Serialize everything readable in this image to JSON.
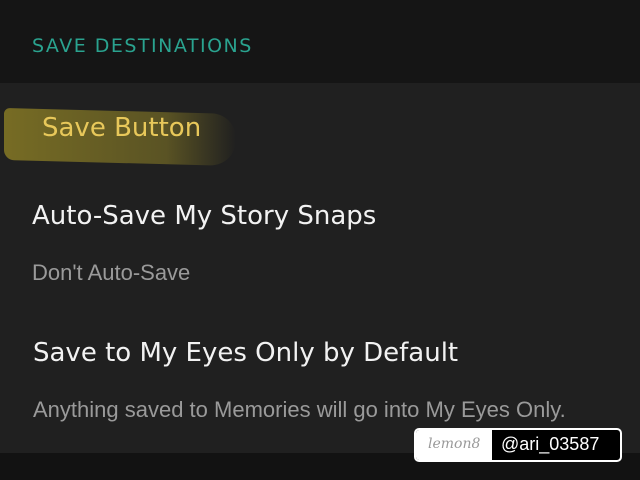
{
  "header": {
    "section_title": "SAVE DESTINATIONS"
  },
  "annotation": {
    "highlighted_label": "Save Button"
  },
  "settings": [
    {
      "title": "Auto-Save My Story Snaps",
      "subtitle": "Don't Auto-Save"
    },
    {
      "title": "Save to My Eyes Only by Default",
      "subtitle": "Anything saved to Memories will go into My Eyes Only."
    }
  ],
  "watermark": {
    "logo_text": "lemon8",
    "handle": "@ari_03587"
  },
  "colors": {
    "accent": "#2aa38f",
    "highlight": "#e8c85a",
    "panel": "#202020",
    "background": "#121212"
  }
}
